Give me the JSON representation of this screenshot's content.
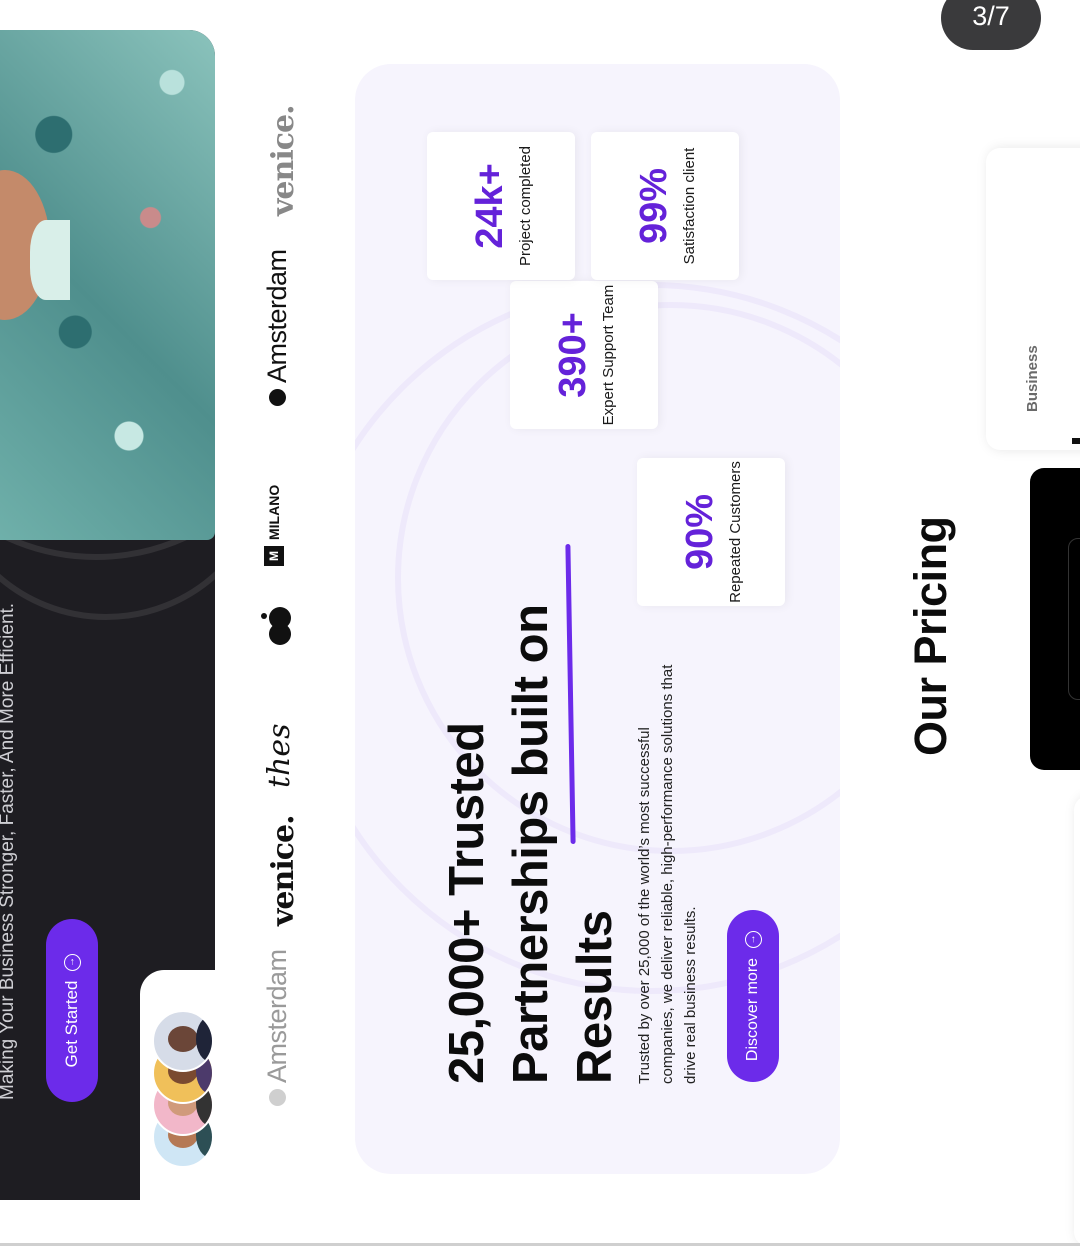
{
  "viewer": {
    "page_counter": "3/7"
  },
  "hero": {
    "tagline": "Making Your Business Stronger, Faster, And More Efficient.",
    "cta_label": "Get Started"
  },
  "logos": [
    {
      "name": "Amsterdam",
      "style": "faded"
    },
    {
      "name": "venice.",
      "style": "normal"
    },
    {
      "name": "thes",
      "style": "script"
    },
    {
      "name": "apple-like",
      "style": "mark"
    },
    {
      "name": "MILANO",
      "badge": "M"
    },
    {
      "name": "Amsterdam",
      "style": "normal"
    },
    {
      "name": "venice.",
      "style": "faded"
    }
  ],
  "partnership": {
    "headline": "25,000+ Trusted Partnerships built on Results",
    "description": "Trusted by over 25,000 of the world’s most successful companies, we deliver reliable, high-performance solutions that drive real business results.",
    "cta_label": "Discover more",
    "stats": [
      {
        "value": "90%",
        "label": "Repeated Customers"
      },
      {
        "value": "390+",
        "label": "Expert Support Team"
      },
      {
        "value": "24k+",
        "label": "Project completed"
      },
      {
        "value": "99%",
        "label": "Satisfaction client"
      }
    ]
  },
  "pricing": {
    "title": "Our Pricing",
    "plans": [
      {
        "name": "Business"
      }
    ]
  },
  "colors": {
    "accent": "#6c2bea",
    "stat_value": "#6422d9",
    "hero_bg": "#1e1d22",
    "card_bg": "#f6f4fd"
  }
}
